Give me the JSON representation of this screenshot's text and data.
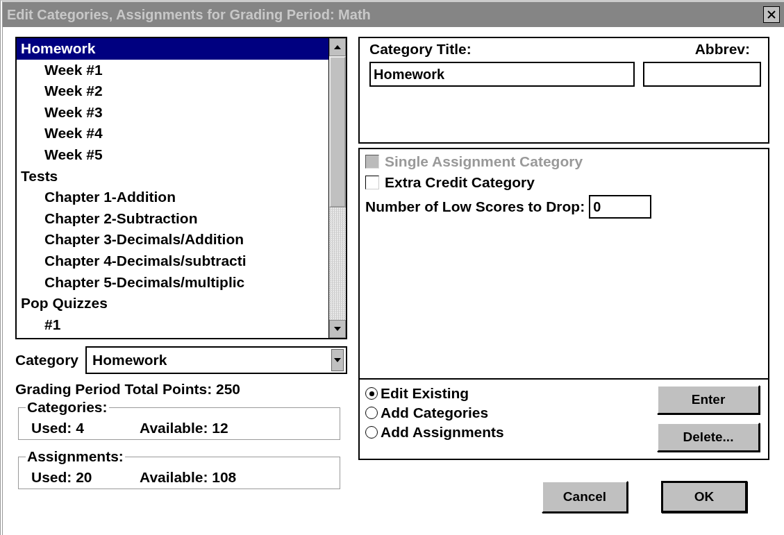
{
  "window": {
    "title": "Edit Categories, Assignments for Grading Period: Math"
  },
  "tree": [
    {
      "label": "Homework",
      "selected": true,
      "children": [
        {
          "label": "Week #1",
          "selected": false
        },
        {
          "label": "Week #2",
          "selected": false
        },
        {
          "label": "Week #3",
          "selected": false
        },
        {
          "label": "Week #4",
          "selected": false
        },
        {
          "label": "Week #5",
          "selected": false
        }
      ]
    },
    {
      "label": "Tests",
      "selected": false,
      "children": [
        {
          "label": "Chapter 1-Addition",
          "selected": false
        },
        {
          "label": "Chapter 2-Subtraction",
          "selected": false
        },
        {
          "label": "Chapter 3-Decimals/Addition",
          "selected": false
        },
        {
          "label": "Chapter 4-Decimals/subtracti",
          "selected": false
        },
        {
          "label": "Chapter 5-Decimals/multiplic",
          "selected": false
        }
      ]
    },
    {
      "label": "Pop Quizzes",
      "selected": false,
      "children": [
        {
          "label": "#1",
          "selected": false
        }
      ]
    }
  ],
  "category": {
    "label": "Category",
    "value": "Homework"
  },
  "total_points": "Grading Period Total Points: 250",
  "groups": [
    {
      "title": "Categories:",
      "used": "Used: 4",
      "available": "Available: 12"
    },
    {
      "title": "Assignments:",
      "used": "Used: 20",
      "available": "Available: 108"
    }
  ],
  "title_field": {
    "label": "Category Title:",
    "value": "Homework"
  },
  "abbrev_field": {
    "label": "Abbrev:"
  },
  "checkboxes": [
    {
      "label": "Single Assignment Category",
      "checked": false,
      "disabled": true
    },
    {
      "label": "Extra Credit Category",
      "checked": false,
      "disabled": false
    }
  ],
  "drop_field": {
    "label": "Number of Low Scores to Drop:",
    "value": "0"
  },
  "modes": [
    {
      "label": "Edit Existing",
      "selected": true
    },
    {
      "label": "Add Categories",
      "selected": false
    },
    {
      "label": "Add Assignments",
      "selected": false
    }
  ],
  "side_buttons": [
    "Enter",
    "Delete..."
  ],
  "buttons": [
    "Cancel",
    "OK"
  ]
}
